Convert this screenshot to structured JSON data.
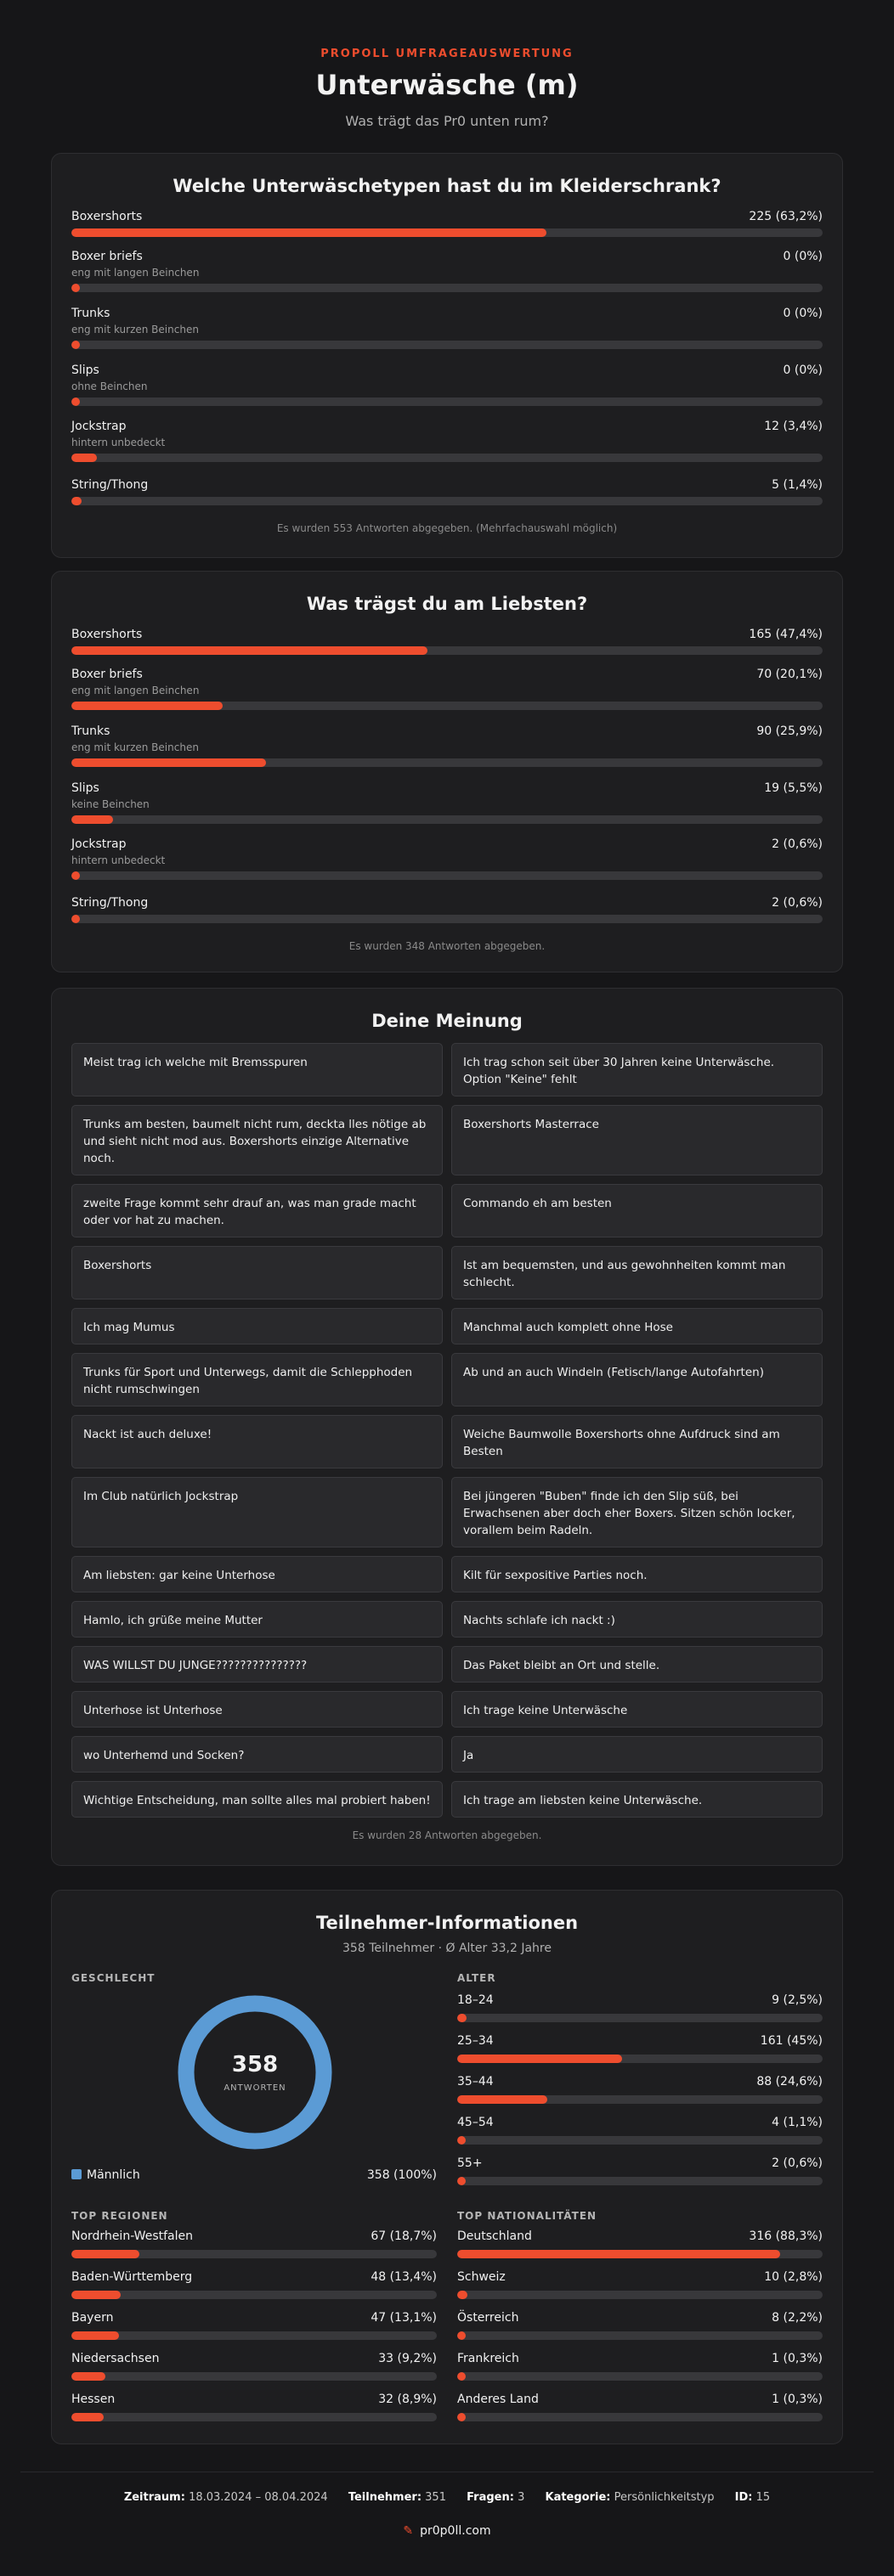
{
  "header": {
    "eyebrow": "PROPOLL UMFRAGEAUSWERTUNG",
    "title": "Unterwäsche (m)",
    "subtitle": "Was trägt das Pr0 unten rum?"
  },
  "q1": {
    "title": "Welche Unterwäschetypen hast du im Kleiderschrank?",
    "items": [
      {
        "label": "Boxershorts",
        "sub": "",
        "value": "225 (63,2%)",
        "pct": 63.2
      },
      {
        "label": "Boxer briefs",
        "sub": "eng mit langen Beinchen",
        "value": "0 (0%)",
        "pct": 0
      },
      {
        "label": "Trunks",
        "sub": "eng mit kurzen Beinchen",
        "value": "0 (0%)",
        "pct": 0
      },
      {
        "label": "Slips",
        "sub": "ohne Beinchen",
        "value": "0 (0%)",
        "pct": 0
      },
      {
        "label": "Jockstrap",
        "sub": "hintern unbedeckt",
        "value": "12 (3,4%)",
        "pct": 3.4
      },
      {
        "label": "String/Thong",
        "sub": "",
        "value": "5 (1,4%)",
        "pct": 1.4
      }
    ],
    "footnote": "Es wurden 553 Antworten abgegeben. (Mehrfachauswahl möglich)"
  },
  "q2": {
    "title": "Was trägst du am Liebsten?",
    "items": [
      {
        "label": "Boxershorts",
        "sub": "",
        "value": "165 (47,4%)",
        "pct": 47.4
      },
      {
        "label": "Boxer briefs",
        "sub": "eng mit langen Beinchen",
        "value": "70 (20,1%)",
        "pct": 20.1
      },
      {
        "label": "Trunks",
        "sub": "eng mit kurzen Beinchen",
        "value": "90 (25,9%)",
        "pct": 25.9
      },
      {
        "label": "Slips",
        "sub": "keine Beinchen",
        "value": "19 (5,5%)",
        "pct": 5.5
      },
      {
        "label": "Jockstrap",
        "sub": "hintern unbedeckt",
        "value": "2 (0,6%)",
        "pct": 0.6
      },
      {
        "label": "String/Thong",
        "sub": "",
        "value": "2 (0,6%)",
        "pct": 0.6
      }
    ],
    "footnote": "Es wurden 348 Antworten abgegeben."
  },
  "opinions": {
    "title": "Deine Meinung",
    "items": [
      "Meist trag ich welche mit Bremsspuren",
      "Ich trag schon seit über 30 Jahren keine Unterwäsche. Option \"Keine\" fehlt",
      "Trunks am besten, baumelt nicht rum, deckta lles nötige ab und sieht nicht mod aus. Boxershorts einzige Alternative noch.",
      "Boxershorts Masterrace",
      "zweite Frage kommt sehr drauf an, was man grade macht oder vor hat zu machen.",
      "Commando eh am besten",
      "Boxershorts",
      "Ist am bequemsten, und aus gewohnheiten kommt man schlecht.",
      "Ich mag Mumus",
      "Manchmal auch komplett ohne Hose",
      "Trunks für Sport und Unterwegs, damit die Schlepphoden nicht rumschwingen",
      "Ab und an auch Windeln (Fetisch/lange Autofahrten)",
      "Nackt ist auch deluxe!",
      "Weiche Baumwolle Boxershorts ohne Aufdruck sind am Besten",
      "Im Club natürlich Jockstrap",
      "Bei jüngeren \"Buben\" finde ich den Slip süß, bei Erwachsenen aber doch eher Boxers. Sitzen schön locker, vorallem beim Radeln.",
      "Am liebsten: gar keine Unterhose",
      "Kilt für sexpositive Parties noch.",
      "Hamlo, ich grüße meine Mutter",
      "Nachts schlafe ich nackt :)",
      "WAS WILLST DU JUNGE???????????????",
      "Das Paket bleibt an Ort und stelle.",
      "Unterhose ist Unterhose",
      "Ich trage keine Unterwäsche",
      "wo Unterhemd und Socken?",
      "Ja",
      "Wichtige Entscheidung, man sollte alles mal probiert haben!",
      "Ich trage am liebsten keine Unterwäsche."
    ],
    "footnote": "Es wurden 28 Antworten abgegeben."
  },
  "participants": {
    "title": "Teilnehmer-Informationen",
    "subtitle": "358 Teilnehmer · Ø Alter 33,2 Jahre",
    "gender": {
      "heading": "GESCHLECHT",
      "total": "358",
      "total_label": "ANTWORTEN",
      "color": "#5b9bd5",
      "legend_label": "Männlich",
      "legend_value": "358 (100%)"
    },
    "age": {
      "heading": "ALTER",
      "items": [
        {
          "label": "18–24",
          "value": "9 (2,5%)",
          "pct": 2.5
        },
        {
          "label": "25–34",
          "value": "161 (45%)",
          "pct": 45
        },
        {
          "label": "35–44",
          "value": "88 (24,6%)",
          "pct": 24.6
        },
        {
          "label": "45–54",
          "value": "4 (1,1%)",
          "pct": 1.1
        },
        {
          "label": "55+",
          "value": "2 (0,6%)",
          "pct": 0.6
        }
      ]
    },
    "regions": {
      "heading": "TOP REGIONEN",
      "items": [
        {
          "label": "Nordrhein-Westfalen",
          "value": "67 (18,7%)",
          "pct": 18.7
        },
        {
          "label": "Baden-Württemberg",
          "value": "48 (13,4%)",
          "pct": 13.4
        },
        {
          "label": "Bayern",
          "value": "47 (13,1%)",
          "pct": 13.1
        },
        {
          "label": "Niedersachsen",
          "value": "33 (9,2%)",
          "pct": 9.2
        },
        {
          "label": "Hessen",
          "value": "32 (8,9%)",
          "pct": 8.9
        }
      ]
    },
    "nationalities": {
      "heading": "TOP NATIONALITÄTEN",
      "items": [
        {
          "label": "Deutschland",
          "value": "316 (88,3%)",
          "pct": 88.3
        },
        {
          "label": "Schweiz",
          "value": "10 (2,8%)",
          "pct": 2.8
        },
        {
          "label": "Österreich",
          "value": "8 (2,2%)",
          "pct": 2.2
        },
        {
          "label": "Frankreich",
          "value": "1 (0,3%)",
          "pct": 0.3
        },
        {
          "label": "Anderes Land",
          "value": "1 (0,3%)",
          "pct": 0.3
        }
      ]
    }
  },
  "footer": {
    "zeitraum_label": "Zeitraum:",
    "zeitraum": "18.03.2024 – 08.04.2024",
    "teilnehmer_label": "Teilnehmer:",
    "teilnehmer": "351",
    "fragen_label": "Fragen:",
    "fragen": "3",
    "kategorie_label": "Kategorie:",
    "kategorie": "Persönlichkeitstyp",
    "id_label": "ID:",
    "id": "15",
    "brand": "pr0p0ll.com",
    "brand_icon": "pen-icon"
  },
  "colors": {
    "accent": "#ee4d2e",
    "male": "#5b9bd5",
    "track": "#38383b"
  }
}
